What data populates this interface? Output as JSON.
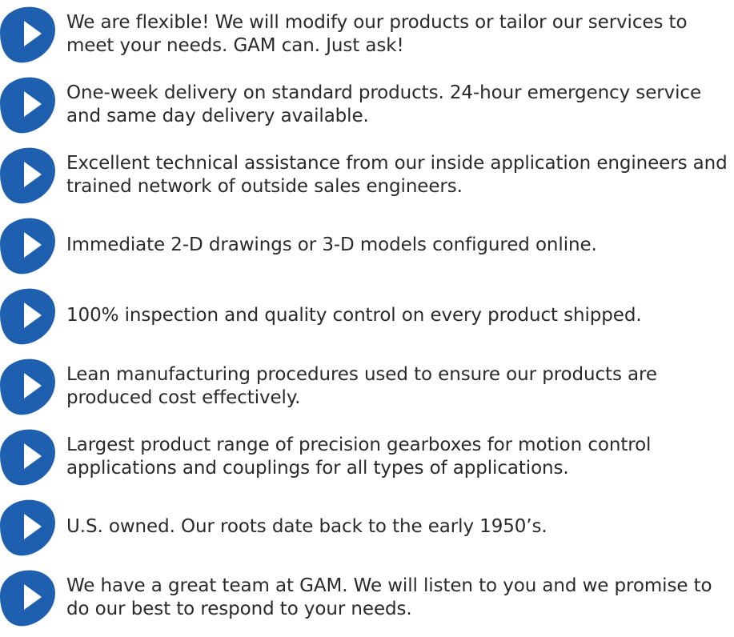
{
  "accent_color": "#1f5fb0",
  "bullet_icon": "play-triangle-icon",
  "items": [
    {
      "text": "We are flexible! We will modify our products or tailor our services to meet your needs.  GAM can. Just ask!"
    },
    {
      "text": "One-week delivery on standard products. 24-hour emergency service and same day delivery available."
    },
    {
      "text": "Excellent technical assistance from our inside application engineers and trained network of outside sales engineers."
    },
    {
      "text": "Immediate 2-D drawings or 3-D models configured online."
    },
    {
      "text": "100% inspection and quality control on every product shipped."
    },
    {
      "text": "Lean manufacturing procedures used to ensure our products are produced cost effectively."
    },
    {
      "text": "Largest product range of precision gearboxes for motion control applications and couplings for all types of applications."
    },
    {
      "text": "U.S. owned. Our roots date back to the early 1950’s."
    },
    {
      "text": "We have a great team at GAM. We will listen to you and we promise to do our best to respond to your needs."
    }
  ]
}
